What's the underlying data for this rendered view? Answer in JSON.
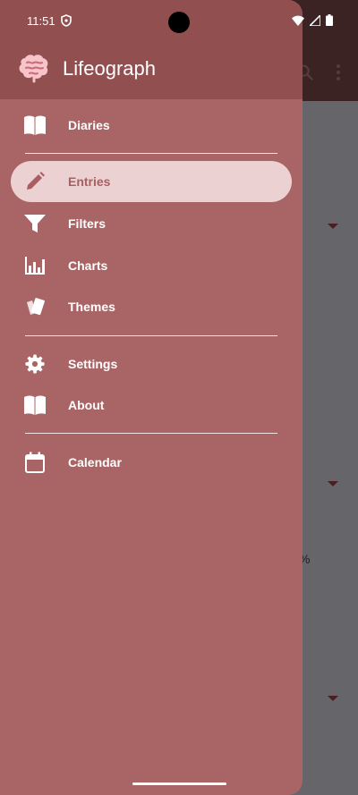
{
  "status": {
    "time": "11:51"
  },
  "app": {
    "title": "Lifeograph"
  },
  "nav": {
    "diaries": "Diaries",
    "entries": "Entries",
    "filters": "Filters",
    "charts": "Charts",
    "themes": "Themes",
    "settings": "Settings",
    "about": "About",
    "calendar": "Calendar"
  },
  "background": {
    "percent_fragment": "%"
  },
  "colors": {
    "drawer": "#a96565",
    "header": "#924f50",
    "active_bg": "#ecd1d3",
    "active_text": "#a95f61"
  }
}
